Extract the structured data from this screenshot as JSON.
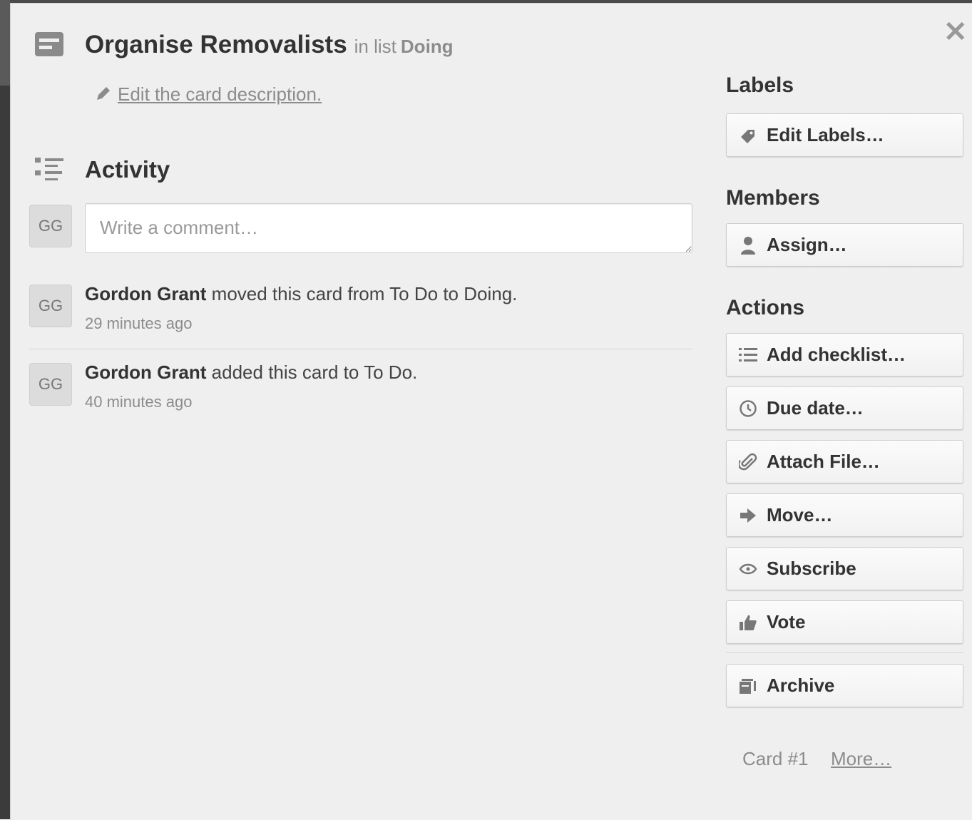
{
  "card": {
    "title": "Organise Removalists",
    "in_list_prefix": "in list",
    "list_name": "Doing",
    "edit_description_link": "Edit the card description."
  },
  "activity": {
    "heading": "Activity",
    "comment_placeholder": "Write a comment…",
    "current_user_initials": "GG",
    "items": [
      {
        "initials": "GG",
        "user": "Gordon Grant",
        "action": "moved this card from To Do to Doing.",
        "time": "29 minutes ago"
      },
      {
        "initials": "GG",
        "user": "Gordon Grant",
        "action": "added this card to To Do.",
        "time": "40 minutes ago"
      }
    ]
  },
  "sidebar": {
    "labels_heading": "Labels",
    "edit_labels": "Edit Labels…",
    "members_heading": "Members",
    "assign": "Assign…",
    "actions_heading": "Actions",
    "actions": [
      {
        "label": "Add checklist…",
        "icon": "checklist-icon"
      },
      {
        "label": "Due date…",
        "icon": "clock-icon"
      },
      {
        "label": "Attach File…",
        "icon": "paperclip-icon"
      },
      {
        "label": "Move…",
        "icon": "arrow-right-icon"
      },
      {
        "label": "Subscribe",
        "icon": "eye-icon"
      },
      {
        "label": "Vote",
        "icon": "thumbs-up-icon"
      }
    ],
    "archive": "Archive"
  },
  "footer": {
    "card_number": "Card #1",
    "more_link": "More…"
  }
}
